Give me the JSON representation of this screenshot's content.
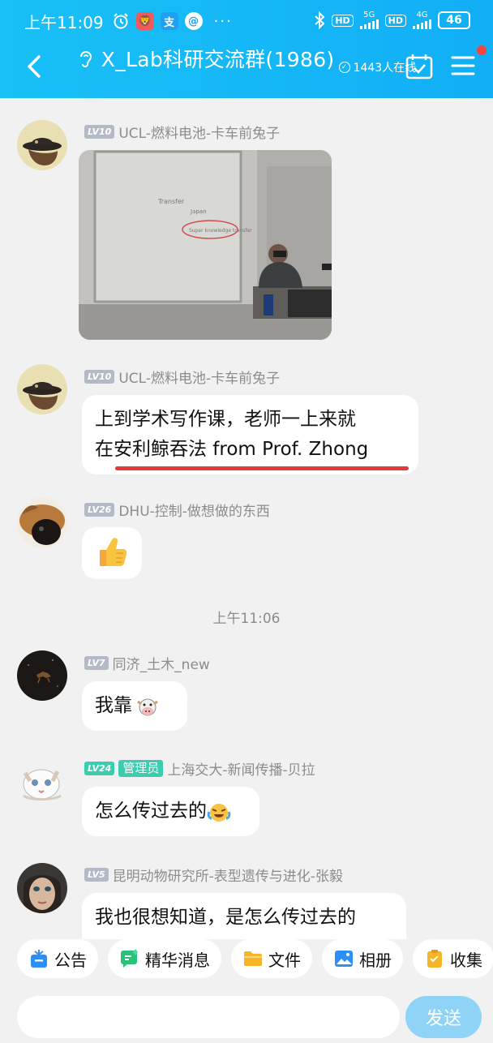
{
  "status": {
    "time": "上午11:09",
    "battery": "46",
    "net1": "5G",
    "net2": "4G",
    "hd": "HD"
  },
  "header": {
    "title": "X_Lab科研交流群(1986)",
    "online": "1443人在线"
  },
  "messages": [
    {
      "level": "LV10",
      "name": "UCL-燃料电池-卡车前兔子",
      "type": "image",
      "photo_text": [
        "Transfer",
        "Japan",
        "Super knowledge transfer"
      ]
    },
    {
      "level": "LV10",
      "name": "UCL-燃料电池-卡车前兔子",
      "type": "text",
      "lines": [
        "上到学术写作课，老师一上来就",
        "在安利鲸吞法 from Prof. Zhong"
      ]
    },
    {
      "level": "LV26",
      "name": "DHU-控制-做想做的东西",
      "type": "emoji",
      "text": "👍"
    },
    {
      "level": "LV7",
      "name": "同济_土木_new",
      "type": "text",
      "text": "我靠 "
    },
    {
      "level": "LV24",
      "badge": "管理员",
      "name": "上海交大-新闻传播-贝拉",
      "type": "text",
      "text": "怎么传过去的"
    },
    {
      "level": "LV5",
      "name": "昆明动物研究所-表型遗传与进化-张毅",
      "type": "text",
      "text": "我也很想知道，是怎么传过去的"
    }
  ],
  "timestamp": "上午11:06",
  "quickbar": [
    {
      "label": "公告",
      "icon": "announcement-icon",
      "color": "#2a8ff7"
    },
    {
      "label": "精华消息",
      "icon": "essence-icon",
      "color": "#29c27a"
    },
    {
      "label": "文件",
      "icon": "folder-icon",
      "color": "#f6b429"
    },
    {
      "label": "相册",
      "icon": "album-icon",
      "color": "#2a8ff7"
    },
    {
      "label": "收集",
      "icon": "collect-icon",
      "color": "#f6b429"
    }
  ],
  "input": {
    "send_label": "发送"
  },
  "colors": {
    "header": "#15b8f6",
    "send": "#8fd3f7",
    "admin": "#3ccdaf",
    "underline": "#e53a3a"
  }
}
